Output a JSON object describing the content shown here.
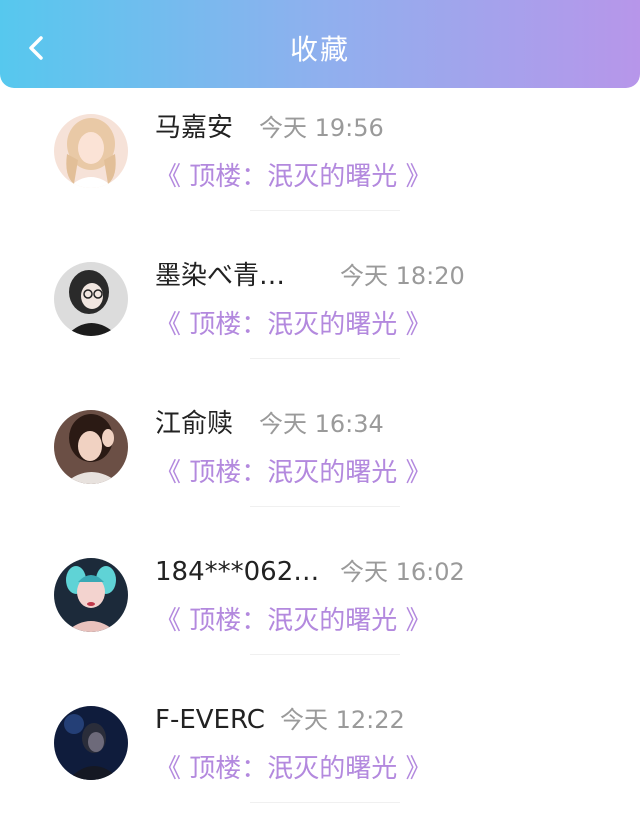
{
  "header": {
    "title": "收藏",
    "back_icon": "chevron-left-icon",
    "gradient_colors": [
      "#56c8ee",
      "#b796ea"
    ]
  },
  "favorites": [
    {
      "name": "马嘉安",
      "time": "今天 19:56",
      "work": "《 顶楼：泯灭的曙光 》"
    },
    {
      "name": "墨染べ青…",
      "time": "今天 18:20",
      "work": "《 顶楼：泯灭的曙光 》"
    },
    {
      "name": "江俞赎",
      "time": "今天 16:34",
      "work": "《 顶楼：泯灭的曙光 》"
    },
    {
      "name": "184***062…",
      "time": "今天 16:02",
      "work": "《 顶楼：泯灭的曙光 》"
    },
    {
      "name": "F-EVERC",
      "time": "今天 12:22",
      "work": "《 顶楼：泯灭的曙光 》"
    }
  ],
  "colors": {
    "accent": "#b389de",
    "time_text": "#9a9a9a",
    "name_text": "#222222"
  }
}
